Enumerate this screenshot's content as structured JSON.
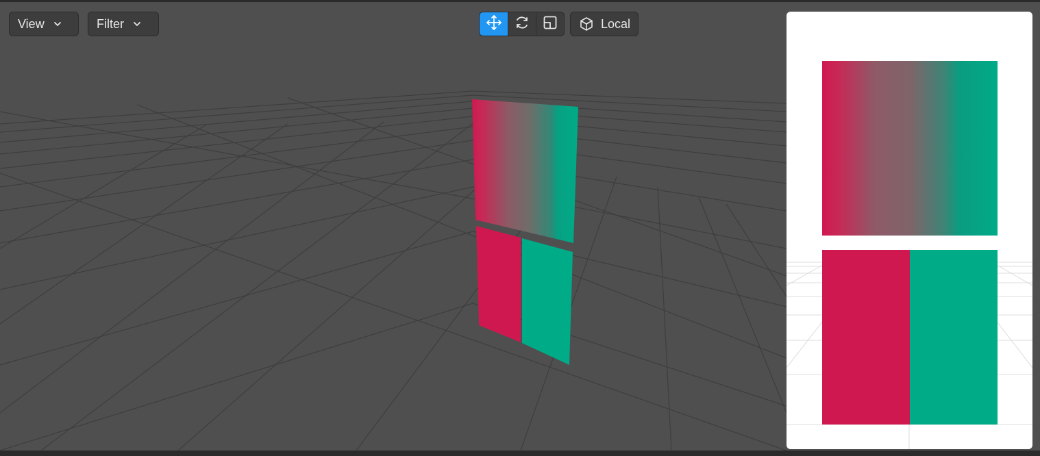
{
  "toolbar": {
    "view": {
      "label": "View",
      "icon": "chevron-down-icon"
    },
    "filter": {
      "label": "Filter",
      "icon": "chevron-down-icon"
    },
    "transform_tools": [
      {
        "name": "move",
        "icon": "move-arrows-icon",
        "active": true
      },
      {
        "name": "rotate",
        "icon": "rotate-icon",
        "active": false
      },
      {
        "name": "scale",
        "icon": "scale-icon",
        "active": false
      }
    ],
    "space": {
      "label": "Local",
      "icon": "cube-icon"
    }
  },
  "colors": {
    "accent": "#2196f3",
    "crimson": "#d01850",
    "teal": "#00ab88",
    "viewport_bg": "#4f4f4f",
    "grid_line": "#3e3e3e"
  },
  "scene": {
    "objects": [
      "gradient-plane",
      "split-color-plane"
    ]
  },
  "preview": {
    "objects": [
      "gradient-plane",
      "split-color-plane"
    ]
  }
}
